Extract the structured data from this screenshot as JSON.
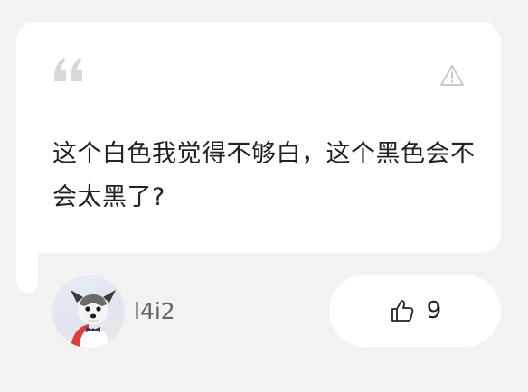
{
  "comment": {
    "text": "这个白色我觉得不够白，这个黑色会不会太黑了?",
    "quote_icon": "quote-mark-icon",
    "report_icon": "warning-triangle-icon"
  },
  "author": {
    "username": "l4i2",
    "avatar_icon": "dog-avatar"
  },
  "like": {
    "icon": "thumbs-up-icon",
    "count": "9"
  },
  "colors": {
    "background": "#f2f2f2",
    "card": "#ffffff",
    "text": "#222222",
    "muted": "#666666",
    "icon_gray": "#cccccc"
  }
}
